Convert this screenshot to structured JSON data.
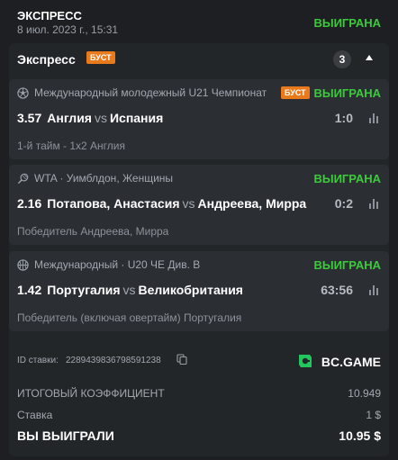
{
  "header": {
    "title": "ЭКСПРЕСС",
    "date": "8 июл. 2023 г., 15:31",
    "status": "ВЫИГРАНА"
  },
  "express": {
    "label": "Экспресс",
    "boost": "БУСТ",
    "count": "3",
    "collapse_icon": "chevron-up-icon"
  },
  "events": [
    {
      "sport_icon": "football-icon",
      "league": "Международный молодежный U21 Чемпионат",
      "boost": "БУСТ",
      "status": "ВЫИГРАНА",
      "odd": "3.57",
      "home": "Англия",
      "vs": "vs",
      "away": "Испания",
      "score": "1:0",
      "outcome": "1-й тайм - 1x2 Англия"
    },
    {
      "sport_icon": "tennis-icon",
      "league": "WTA · Уимблдон, Женщины",
      "status": "ВЫИГРАНА",
      "odd": "2.16",
      "home": "Потапова, Анастасия",
      "vs": "vs",
      "away": "Андреева, Мирра",
      "score": "0:2",
      "outcome": "Победитель Андреева, Мирра"
    },
    {
      "sport_icon": "basketball-icon",
      "league": "Международный · U20 ЧЕ Див. B",
      "status": "ВЫИГРАНА",
      "odd": "1.42",
      "home": "Португалия",
      "vs": "vs",
      "away": "Великобритания",
      "score": "63:56",
      "outcome": "Победитель (включая овертайм) Португалия"
    }
  ],
  "bet": {
    "id_label": "ID ставки:",
    "id_value": "2289439836798591238",
    "brand": "BC.GAME"
  },
  "summary": {
    "coef_label": "ИТОГОВЫЙ КОЭФФИЦИЕНТ",
    "coef_value": "10.949",
    "stake_label": "Ставка",
    "stake_value": "1 $",
    "win_label": "ВЫ ВЫИГРАЛИ",
    "win_value": "10.95 $"
  },
  "colors": {
    "background": "#1d1f22",
    "card": "#2b2e33",
    "won": "#3cc93c",
    "boost": "#e87a1c",
    "brand_logo": "#22c55e"
  }
}
